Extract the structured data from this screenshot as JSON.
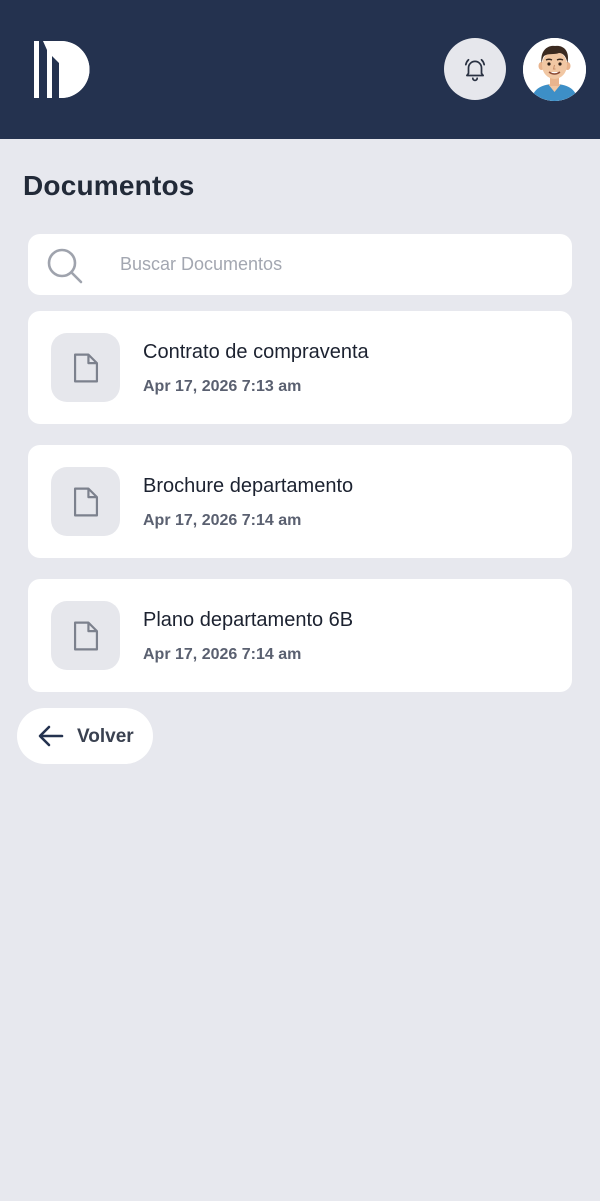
{
  "header": {
    "logo_icon": "brand-logo-icon",
    "notifications_icon": "bell-icon",
    "avatar_icon": "user-avatar"
  },
  "page": {
    "title": "Documentos"
  },
  "search": {
    "placeholder": "Buscar Documentos",
    "value": "",
    "icon": "search-icon"
  },
  "documents": [
    {
      "title": "Contrato de compraventa",
      "date": "Apr 17, 2026 7:13 am",
      "icon": "file-icon"
    },
    {
      "title": "Brochure departamento",
      "date": "Apr 17, 2026 7:14 am",
      "icon": "file-icon"
    },
    {
      "title": "Plano departamento 6B",
      "date": "Apr 17, 2026 7:14 am",
      "icon": "file-icon"
    }
  ],
  "back": {
    "label": "Volver",
    "icon": "arrow-left-icon"
  },
  "colors": {
    "header_bg": "#24324f",
    "page_bg": "#e7e8ee",
    "card_bg": "#ffffff",
    "icon_tile_bg": "#e6e7ec"
  }
}
